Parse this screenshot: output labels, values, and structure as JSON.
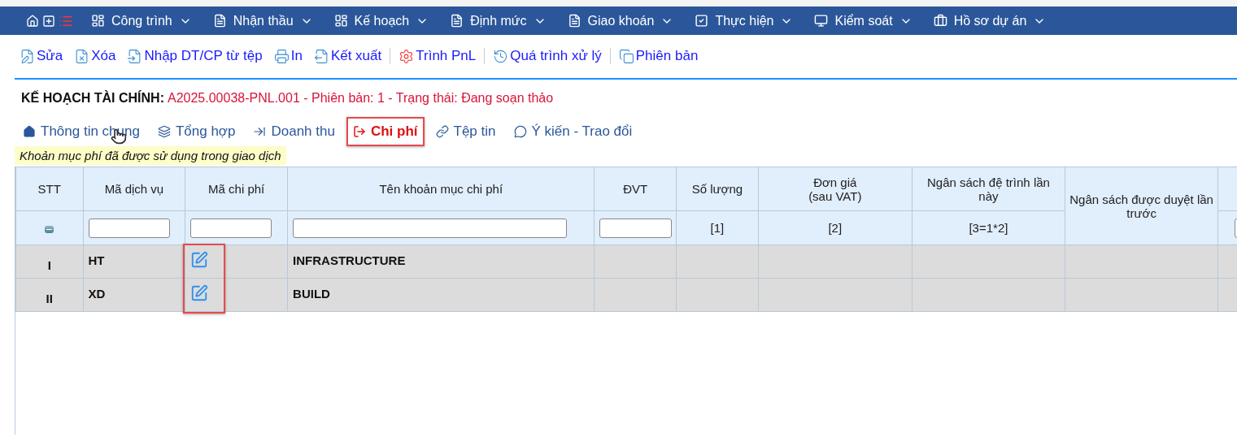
{
  "nav": {
    "items": [
      {
        "label": "Công trình"
      },
      {
        "label": "Nhận thầu"
      },
      {
        "label": "Kế hoạch"
      },
      {
        "label": "Định mức"
      },
      {
        "label": "Giao khoán"
      },
      {
        "label": "Thực hiện"
      },
      {
        "label": "Kiểm soát"
      },
      {
        "label": "Hồ sơ dự án"
      }
    ]
  },
  "toolbar": {
    "groups": [
      [
        "Sửa",
        "Xóa",
        "Nhập DT/CP từ tệp",
        "In",
        "Kết xuất"
      ],
      [
        "Trình PnL"
      ],
      [
        "Quá trình xử lý"
      ],
      [
        "Phiên bản"
      ]
    ]
  },
  "header": {
    "label": "KẾ HOẠCH TÀI CHÍNH:",
    "value": "A2025.00038-PNL.001 - Phiên bản: 1 - Trạng thái: Đang soạn thảo"
  },
  "tabs": [
    {
      "label": "Thông tin chung",
      "selected": false,
      "highlighted": false
    },
    {
      "label": "Tổng hợp",
      "selected": false,
      "highlighted": false
    },
    {
      "label": "Doanh thu",
      "selected": false,
      "highlighted": false
    },
    {
      "label": "Chi phí",
      "selected": true,
      "highlighted": true
    },
    {
      "label": "Tệp tin",
      "selected": false,
      "highlighted": false
    },
    {
      "label": "Ý kiến - Trao đổi",
      "selected": false,
      "highlighted": false
    }
  ],
  "note": "Khoản mục phí đã được sử dụng trong giao dịch",
  "table": {
    "code_cells_highlighted": true,
    "columns": [
      {
        "label": "STT",
        "kind": "toggle"
      },
      {
        "label": "Mã dịch vụ",
        "kind": "input"
      },
      {
        "label": "Mã chi phí",
        "kind": "input"
      },
      {
        "label": "Tên khoản mục chi phí",
        "kind": "input"
      },
      {
        "label": "ĐVT",
        "kind": "input"
      },
      {
        "label": "Số lượng",
        "kind": "text",
        "filter": "[1]"
      },
      {
        "label": "Đơn giá\n(sau VAT)",
        "kind": "text",
        "filter": "[2]"
      },
      {
        "label": "Ngân sách đệ trình lần này",
        "kind": "text",
        "filter": "[3=1*2]"
      },
      {
        "label": "Ngân sách được duyệt lần trước",
        "kind": "span"
      },
      {
        "kind": "input"
      }
    ],
    "rows": [
      {
        "stt": "I",
        "service": "HT",
        "name": "INFRASTRUCTURE"
      },
      {
        "stt": "II",
        "service": "XD",
        "name": "BUILD"
      }
    ]
  }
}
